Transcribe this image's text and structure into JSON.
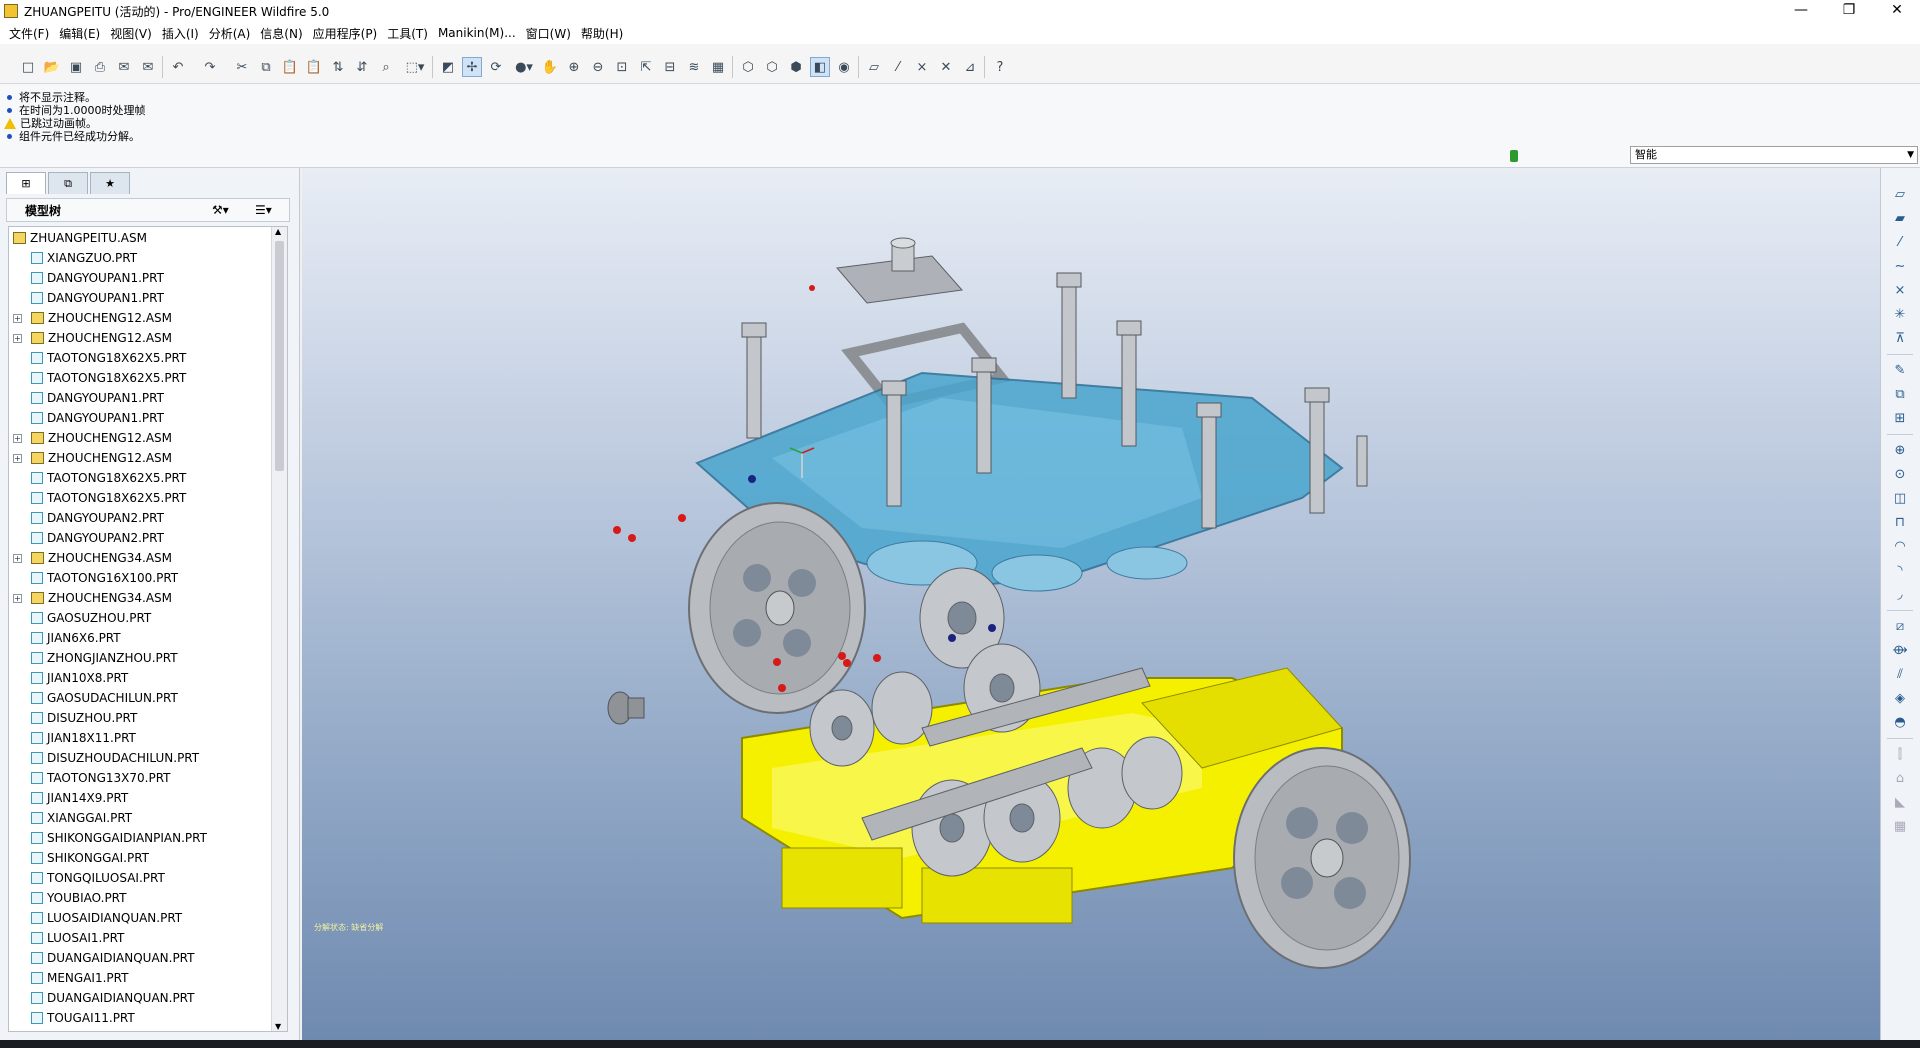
{
  "window": {
    "title": "ZHUANGPEITU (活动的) - Pro/ENGINEER Wildfire 5.0",
    "minimize": "—",
    "restore": "❐",
    "close": "✕"
  },
  "menu": [
    "文件(F)",
    "编辑(E)",
    "视图(V)",
    "插入(I)",
    "分析(A)",
    "信息(N)",
    "应用程序(P)",
    "工具(T)",
    "Manikin(M)...",
    "窗口(W)",
    "帮助(H)"
  ],
  "messages": [
    {
      "type": "info",
      "text": "将不显示注释。"
    },
    {
      "type": "info",
      "text": "在时间为1.0000时处理帧"
    },
    {
      "type": "warn",
      "text": "已跳过动画帧。"
    },
    {
      "type": "info",
      "text": "组件元件已经成功分解。"
    }
  ],
  "selection_filter": {
    "value": "智能"
  },
  "model_tree": {
    "title": "模型树",
    "items": [
      {
        "name": "ZHUANGPEITU.ASM",
        "kind": "asm",
        "level": 0,
        "expandable": false
      },
      {
        "name": "XIANGZUO.PRT",
        "kind": "prt",
        "level": 1,
        "expandable": false
      },
      {
        "name": "DANGYOUPAN1.PRT",
        "kind": "prt",
        "level": 1,
        "expandable": false
      },
      {
        "name": "DANGYOUPAN1.PRT",
        "kind": "prt",
        "level": 1,
        "expandable": false
      },
      {
        "name": "ZHOUCHENG12.ASM",
        "kind": "asm",
        "level": 1,
        "expandable": true
      },
      {
        "name": "ZHOUCHENG12.ASM",
        "kind": "asm",
        "level": 1,
        "expandable": true
      },
      {
        "name": "TAOTONG18X62X5.PRT",
        "kind": "prt",
        "level": 1,
        "expandable": false
      },
      {
        "name": "TAOTONG18X62X5.PRT",
        "kind": "prt",
        "level": 1,
        "expandable": false
      },
      {
        "name": "DANGYOUPAN1.PRT",
        "kind": "prt",
        "level": 1,
        "expandable": false
      },
      {
        "name": "DANGYOUPAN1.PRT",
        "kind": "prt",
        "level": 1,
        "expandable": false
      },
      {
        "name": "ZHOUCHENG12.ASM",
        "kind": "asm",
        "level": 1,
        "expandable": true
      },
      {
        "name": "ZHOUCHENG12.ASM",
        "kind": "asm",
        "level": 1,
        "expandable": true
      },
      {
        "name": "TAOTONG18X62X5.PRT",
        "kind": "prt",
        "level": 1,
        "expandable": false
      },
      {
        "name": "TAOTONG18X62X5.PRT",
        "kind": "prt",
        "level": 1,
        "expandable": false
      },
      {
        "name": "DANGYOUPAN2.PRT",
        "kind": "prt",
        "level": 1,
        "expandable": false
      },
      {
        "name": "DANGYOUPAN2.PRT",
        "kind": "prt",
        "level": 1,
        "expandable": false
      },
      {
        "name": "ZHOUCHENG34.ASM",
        "kind": "asm",
        "level": 1,
        "expandable": true
      },
      {
        "name": "TAOTONG16X100.PRT",
        "kind": "prt",
        "level": 1,
        "expandable": false
      },
      {
        "name": "ZHOUCHENG34.ASM",
        "kind": "asm",
        "level": 1,
        "expandable": true
      },
      {
        "name": "GAOSUZHOU.PRT",
        "kind": "prt",
        "level": 1,
        "expandable": false
      },
      {
        "name": "JIAN6X6.PRT",
        "kind": "prt",
        "level": 1,
        "expandable": false
      },
      {
        "name": "ZHONGJIANZHOU.PRT",
        "kind": "prt",
        "level": 1,
        "expandable": false
      },
      {
        "name": "JIAN10X8.PRT",
        "kind": "prt",
        "level": 1,
        "expandable": false
      },
      {
        "name": "GAOSUDACHILUN.PRT",
        "kind": "prt",
        "level": 1,
        "expandable": false
      },
      {
        "name": "DISUZHOU.PRT",
        "kind": "prt",
        "level": 1,
        "expandable": false
      },
      {
        "name": "JIAN18X11.PRT",
        "kind": "prt",
        "level": 1,
        "expandable": false
      },
      {
        "name": "DISUZHOUDACHILUN.PRT",
        "kind": "prt",
        "level": 1,
        "expandable": false
      },
      {
        "name": "TAOTONG13X70.PRT",
        "kind": "prt",
        "level": 1,
        "expandable": false
      },
      {
        "name": "JIAN14X9.PRT",
        "kind": "prt",
        "level": 1,
        "expandable": false
      },
      {
        "name": "XIANGGAI.PRT",
        "kind": "prt",
        "level": 1,
        "expandable": false
      },
      {
        "name": "SHIKONGGAIDIANPIAN.PRT",
        "kind": "prt",
        "level": 1,
        "expandable": false
      },
      {
        "name": "SHIKONGGAI.PRT",
        "kind": "prt",
        "level": 1,
        "expandable": false
      },
      {
        "name": "TONGQILUOSAI.PRT",
        "kind": "prt",
        "level": 1,
        "expandable": false
      },
      {
        "name": "YOUBIAO.PRT",
        "kind": "prt",
        "level": 1,
        "expandable": false
      },
      {
        "name": "LUOSAIDIANQUAN.PRT",
        "kind": "prt",
        "level": 1,
        "expandable": false
      },
      {
        "name": "LUOSAI1.PRT",
        "kind": "prt",
        "level": 1,
        "expandable": false
      },
      {
        "name": "DUANGAIDIANQUAN.PRT",
        "kind": "prt",
        "level": 1,
        "expandable": false
      },
      {
        "name": "MENGAI1.PRT",
        "kind": "prt",
        "level": 1,
        "expandable": false
      },
      {
        "name": "DUANGAIDIANQUAN.PRT",
        "kind": "prt",
        "level": 1,
        "expandable": false
      },
      {
        "name": "TOUGAI11.PRT",
        "kind": "prt",
        "level": 1,
        "expandable": false
      }
    ]
  },
  "viewport": {
    "label": "分解状态: 缺省分解",
    "colors": {
      "housing_base": "#f5f000",
      "housing_cover": "#4aa6cf",
      "gear": "#b9bcc0",
      "fastener_red": "#d61a1a",
      "fastener_blue": "#1a237e"
    }
  },
  "toolbar_icons": [
    "new-icon",
    "open-icon",
    "save-icon",
    "print-icon",
    "email-icon",
    "email-link-icon",
    "undo-icon",
    "redo-icon",
    "cut-icon",
    "copy-icon",
    "paste-icon",
    "paste-special-icon",
    "regenerate-icon",
    "regen-manager-icon",
    "find-icon",
    "select-box-icon",
    "repaint-icon",
    "spin-center-icon",
    "orient-mode-icon",
    "appearance-icon",
    "pan-icon",
    "zoom-in-icon",
    "zoom-out-icon",
    "refit-icon",
    "reorient-icon",
    "saved-views-icon",
    "layers-icon",
    "view-manager-icon",
    "wireframe-icon",
    "hidden-line-icon",
    "no-hidden-icon",
    "shading-icon",
    "enhanced-realism-icon",
    "datum-planes-icon",
    "datum-axes-icon",
    "datum-points-icon",
    "csys-icon",
    "annotations-icon",
    "help-icon"
  ],
  "right_toolbar_icons": [
    "datum-plane-tool-icon",
    "sketch-plane-icon",
    "datum-axis-icon",
    "datum-curve-icon",
    "datum-point-icon",
    "csys-tool-icon",
    "analysis-tool-icon",
    "sketch-tool-icon",
    "reference-icon",
    "component-place-icon",
    "create-component-icon",
    "hole-icon",
    "round-icon",
    "extrude-icon",
    "revolve-icon",
    "sweep-icon",
    "chamfer-icon",
    "draft-icon",
    "pattern-icon",
    "mirror-icon",
    "shell-icon",
    "rib-icon",
    "boundary-icon",
    "offset-icon",
    "merge-icon",
    "trim-icon",
    "intersect-icon",
    "extend-icon",
    "thicken-icon"
  ]
}
